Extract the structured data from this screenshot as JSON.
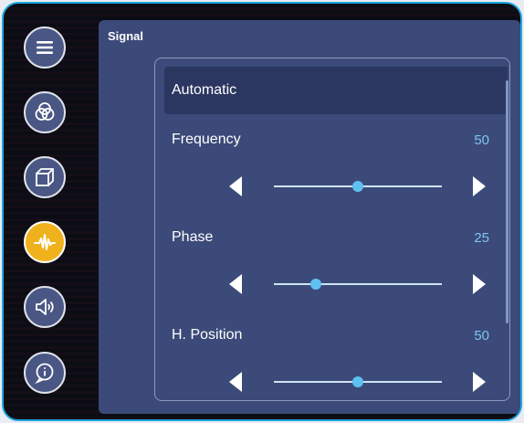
{
  "panel": {
    "title": "Signal"
  },
  "nav": [
    {
      "icon": "menu-icon",
      "active": false
    },
    {
      "icon": "color-circles-icon",
      "active": false
    },
    {
      "icon": "display-cube-icon",
      "active": false
    },
    {
      "icon": "signal-waveform-icon",
      "active": true
    },
    {
      "icon": "speaker-icon",
      "active": false
    },
    {
      "icon": "info-icon",
      "active": false
    }
  ],
  "auto_label": "Automatic",
  "settings": [
    {
      "label": "Frequency",
      "value": "50",
      "level": 0.5
    },
    {
      "label": "Phase",
      "value": "25",
      "level": 0.25
    },
    {
      "label": "H. Position",
      "value": "50",
      "level": 0.5
    }
  ],
  "colors": {
    "accent": "#f0b21c",
    "panel": "#3b4a78",
    "highlight_row": "#2b3760",
    "value_text": "#7fc4f0",
    "border": "#1fa6e0"
  }
}
